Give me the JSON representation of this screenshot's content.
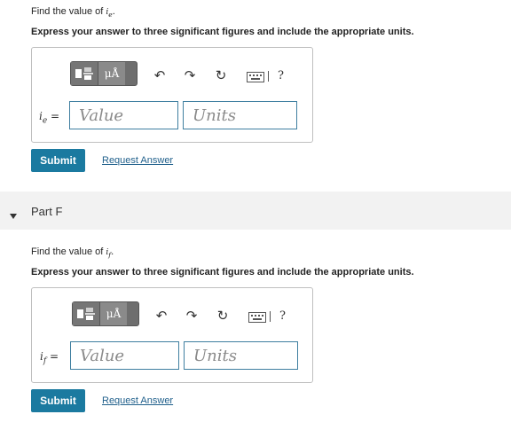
{
  "part_e": {
    "prompt_text": "Find the value of",
    "var_symbol": "i",
    "var_sub": "e",
    "instructions": "Express your answer to three significant figures and include the appropriate units.",
    "units_button": "μÅ",
    "help": "?",
    "label_eq": "=",
    "value_placeholder": "Value",
    "units_placeholder": "Units",
    "submit": "Submit",
    "request_answer": "Request Answer"
  },
  "part_f": {
    "title": "Part F",
    "prompt_text": "Find the value of",
    "var_symbol": "i",
    "var_sub": "f",
    "instructions": "Express your answer to three significant figures and include the appropriate units.",
    "units_button": "μÅ",
    "help": "?",
    "label_eq": "=",
    "value_placeholder": "Value",
    "units_placeholder": "Units",
    "submit": "Submit",
    "request_answer": "Request Answer"
  }
}
